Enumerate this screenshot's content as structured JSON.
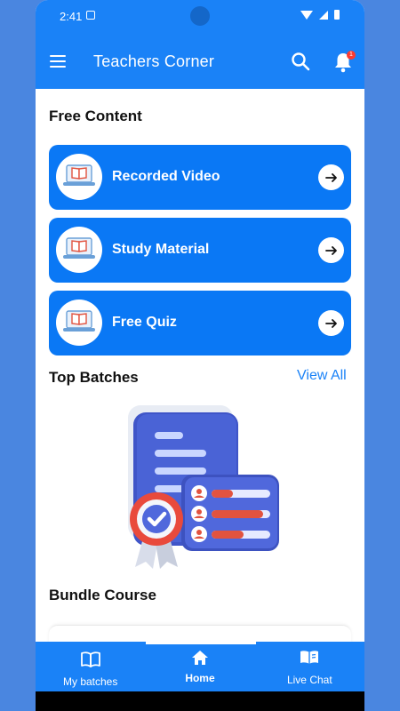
{
  "status_bar": {
    "time": "2:41"
  },
  "app_bar": {
    "title": "Teachers Corner",
    "notification_count": "1"
  },
  "free_content": {
    "title": "Free Content",
    "items": [
      {
        "label": "Recorded Video"
      },
      {
        "label": "Study Material"
      },
      {
        "label": "Free Quiz"
      }
    ]
  },
  "top_batches": {
    "title": "Top Batches",
    "view_all": "View All"
  },
  "bundle_course": {
    "title": "Bundle Course"
  },
  "bottom_nav": {
    "items": [
      {
        "label": "My batches",
        "icon": "book-icon"
      },
      {
        "label": "Home",
        "icon": "home-icon",
        "active": true
      },
      {
        "label": "Live Chat",
        "icon": "open-book-icon"
      }
    ]
  },
  "colors": {
    "primary": "#1a82f7",
    "card": "#0a78f5",
    "background": "#4a86e0"
  }
}
